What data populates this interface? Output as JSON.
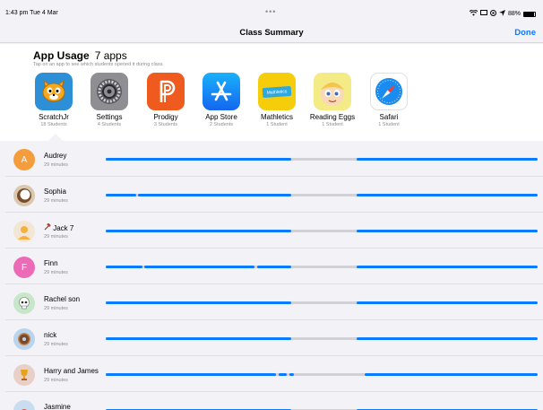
{
  "status": {
    "time": "1:43 pm  Tue 4 Mar",
    "battery": "88%",
    "dots": "•••"
  },
  "nav": {
    "title": "Class Summary",
    "done": "Done"
  },
  "usage": {
    "title": "App Usage",
    "count": "7 apps",
    "subtitle": "Tap on an app to see which students opened it during class.",
    "apps": [
      {
        "name": "ScratchJr",
        "count": "18 Students",
        "icon": "scratchjr-cat-icon",
        "color": "#2d8fd5",
        "selected": true
      },
      {
        "name": "Settings",
        "count": "4 Students",
        "icon": "settings-gear-icon",
        "color": "#8e8e93"
      },
      {
        "name": "Prodigy",
        "count": "3 Students",
        "icon": "prodigy-p-icon",
        "color": "#ef5a1e"
      },
      {
        "name": "App Store",
        "count": "2 Students",
        "icon": "app-store-icon",
        "color": "#1686f8"
      },
      {
        "name": "Mathletics",
        "count": "1 Student",
        "icon": "mathletics-icon",
        "color": "#f6cd0b"
      },
      {
        "name": "Reading Eggs",
        "count": "1 Student",
        "icon": "reading-eggs-icon",
        "color": "#f4ea86"
      },
      {
        "name": "Safari",
        "count": "1 Student",
        "icon": "safari-compass-icon",
        "color": "#1a8cf0"
      }
    ]
  },
  "students": [
    {
      "name": "Audrey",
      "time": "29 minutes",
      "avatar": "A",
      "avatar_icon": "initial-avatar",
      "avatar_color": "#f59c3c",
      "segments": [
        [
          0.0,
          0.43
        ],
        [
          0.58,
          1.0
        ]
      ]
    },
    {
      "name": "Sophia",
      "time": "29 minutes",
      "avatar": "",
      "avatar_icon": "coconut-emoji-icon",
      "avatar_color": "#d9c7b0",
      "segments": [
        [
          0.0,
          0.07
        ],
        [
          0.075,
          0.43
        ],
        [
          0.58,
          1.0
        ]
      ]
    },
    {
      "name": "Jack 7",
      "time": "29 minutes",
      "avatar": "",
      "avatar_icon": "person-avatar-icon",
      "avatar_color": "#f3e6d5",
      "name_icon": "hammer-emoji-icon",
      "segments": [
        [
          0.0,
          0.43
        ],
        [
          0.58,
          1.0
        ]
      ]
    },
    {
      "name": "Finn",
      "time": "29 minutes",
      "avatar": "F",
      "avatar_icon": "initial-avatar",
      "avatar_color": "#ec6bb6",
      "segments": [
        [
          0.0,
          0.085
        ],
        [
          0.09,
          0.345
        ],
        [
          0.35,
          0.43
        ],
        [
          0.58,
          1.0
        ]
      ]
    },
    {
      "name": "Rachel son",
      "time": "29 minutes",
      "avatar": "",
      "avatar_icon": "skull-emoji-icon",
      "avatar_color": "#c8e6c9",
      "segments": [
        [
          0.0,
          0.43
        ],
        [
          0.58,
          1.0
        ]
      ]
    },
    {
      "name": "nick",
      "time": "29 minutes",
      "avatar": "",
      "avatar_icon": "donut-emoji-icon",
      "avatar_color": "#b8d4ee",
      "segments": [
        [
          0.0,
          0.43
        ],
        [
          0.58,
          1.0
        ]
      ]
    },
    {
      "name": "Harry and James",
      "time": "29 minutes",
      "avatar": "",
      "avatar_icon": "trophy-emoji-icon",
      "avatar_color": "#e8d0c8",
      "segments": [
        [
          0.0,
          0.395
        ],
        [
          0.4,
          0.42
        ],
        [
          0.425,
          0.435
        ],
        [
          0.6,
          1.0
        ]
      ]
    },
    {
      "name": "Jasmine",
      "time": "",
      "avatar": "",
      "avatar_icon": "emoji-avatar-icon",
      "avatar_color": "#c9ddf0",
      "segments": [
        [
          0.0,
          0.43
        ],
        [
          0.58,
          1.0
        ]
      ]
    }
  ]
}
